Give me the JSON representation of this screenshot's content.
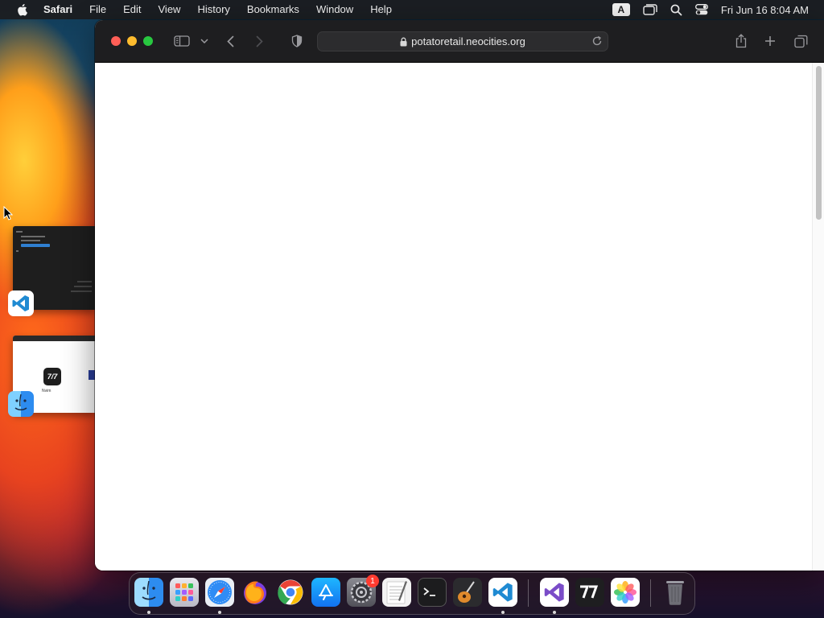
{
  "menubar": {
    "app_name": "Safari",
    "menus": [
      "File",
      "Edit",
      "View",
      "History",
      "Bookmarks",
      "Window",
      "Help"
    ],
    "keyboard_indicator": "A",
    "clock": "Fri Jun 16  8:04 AM"
  },
  "safari": {
    "url": "potatoretail.neocities.org",
    "colors": {
      "toolbar": "#1e1e20",
      "address_bar": "#2c2c2e",
      "page": "#ffffff"
    }
  },
  "stage_manager": {
    "windows": [
      {
        "app": "vscode",
        "icon": "vscode-icon"
      },
      {
        "app": "nvim",
        "icon": "finder-icon",
        "thumb_label": "Nvim",
        "thumb_logo": "7/7"
      }
    ]
  },
  "dock": {
    "apps": [
      {
        "name": "Finder",
        "icon": "finder-icon",
        "running": true
      },
      {
        "name": "Launchpad",
        "icon": "launchpad-icon",
        "running": false
      },
      {
        "name": "Safari",
        "icon": "safari-icon",
        "running": true
      },
      {
        "name": "Firefox",
        "icon": "firefox-icon",
        "running": false
      },
      {
        "name": "Chrome",
        "icon": "chrome-icon",
        "running": false
      },
      {
        "name": "App Store",
        "icon": "app-store-icon",
        "running": false
      },
      {
        "name": "System Settings",
        "icon": "system-settings-icon",
        "running": false,
        "badge": "1"
      },
      {
        "name": "TextEdit",
        "icon": "textedit-icon",
        "running": false
      },
      {
        "name": "Terminal",
        "icon": "terminal-icon",
        "running": false
      },
      {
        "name": "GarageBand",
        "icon": "garageband-icon",
        "running": false
      },
      {
        "name": "Visual Studio Code",
        "icon": "vscode-icon",
        "running": true
      },
      {
        "name": "Visual Studio",
        "icon": "visual-studio-icon",
        "running": true
      },
      {
        "name": "Nvim",
        "icon": "nvim-icon",
        "running": false
      },
      {
        "name": "Photos",
        "icon": "photos-icon",
        "running": false
      },
      {
        "name": "Trash",
        "icon": "trash-icon",
        "running": false
      }
    ]
  }
}
